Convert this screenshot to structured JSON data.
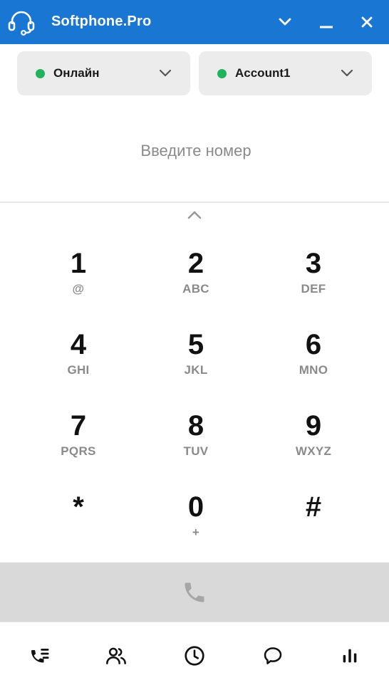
{
  "app": {
    "title": "Softphone.Pro"
  },
  "status_selector": {
    "label": "Онлайн",
    "dot_color": "#21b35b"
  },
  "account_selector": {
    "label": "Account1",
    "dot_color": "#21b35b"
  },
  "number_input": {
    "value": "",
    "placeholder": "Введите номер"
  },
  "keypad": {
    "keys": [
      {
        "digit": "1",
        "letters": "@"
      },
      {
        "digit": "2",
        "letters": "ABC"
      },
      {
        "digit": "3",
        "letters": "DEF"
      },
      {
        "digit": "4",
        "letters": "GHI"
      },
      {
        "digit": "5",
        "letters": "JKL"
      },
      {
        "digit": "6",
        "letters": "MNO"
      },
      {
        "digit": "7",
        "letters": "PQRS"
      },
      {
        "digit": "8",
        "letters": "TUV"
      },
      {
        "digit": "9",
        "letters": "WXYZ"
      },
      {
        "digit": "*",
        "letters": ""
      },
      {
        "digit": "0",
        "letters": "+"
      },
      {
        "digit": "#",
        "letters": ""
      }
    ]
  },
  "icons": {
    "logo": "headset-icon",
    "title_dropdown": "chevron-down-icon",
    "minimize": "minimize-icon",
    "close": "close-icon",
    "collapse": "chevron-up-icon",
    "call": "phone-icon"
  },
  "bottom_nav": [
    "calls-list-icon",
    "contacts-icon",
    "history-icon",
    "chat-icon",
    "stats-icon"
  ],
  "colors": {
    "brand": "#1976d2",
    "online": "#21b35b",
    "call_bar": "#d9d9d9",
    "call_icon": "#a6a6a6"
  }
}
